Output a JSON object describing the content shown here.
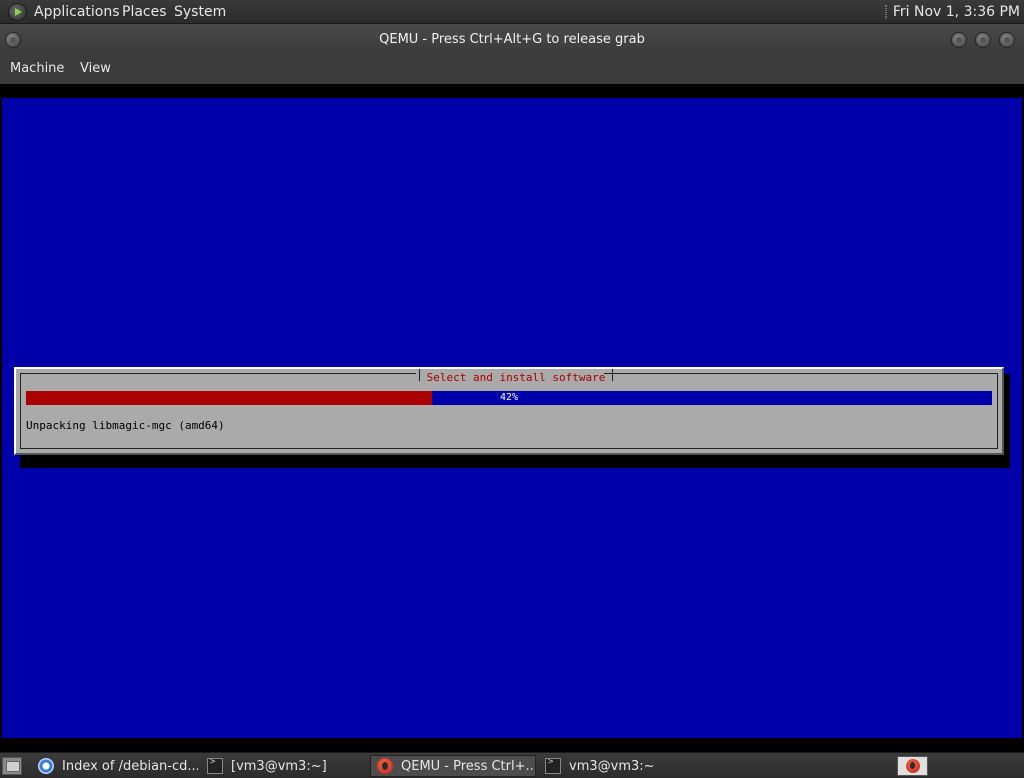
{
  "top_panel": {
    "menus": [
      "Applications",
      "Places",
      "System"
    ],
    "clock": "Fri Nov 1, 3:36 PM"
  },
  "window": {
    "title": "QEMU - Press Ctrl+Alt+G to release grab",
    "menu": [
      "Machine",
      "View"
    ]
  },
  "installer": {
    "dialog_title": "Select and install software",
    "progress_percent": 42,
    "progress_label": "42%",
    "status_text": "Unpacking libmagic-mgc (amd64)",
    "colors": {
      "screen_bg": "#0000aa",
      "dialog_bg": "#aaaaaa",
      "progress_fill": "#aa0000",
      "title_text": "#aa0000"
    }
  },
  "taskbar": {
    "tasks": [
      {
        "icon": "browser-icon",
        "label": "Index of /debian-cd...",
        "active": false
      },
      {
        "icon": "terminal-icon",
        "label": "[vm3@vm3:~]",
        "active": false
      },
      {
        "icon": "qemu-icon",
        "label": "QEMU - Press Ctrl+...",
        "active": true
      },
      {
        "icon": "terminal-icon",
        "label": "vm3@vm3:~",
        "active": false
      }
    ],
    "workspace_icon": "qemu-icon"
  }
}
